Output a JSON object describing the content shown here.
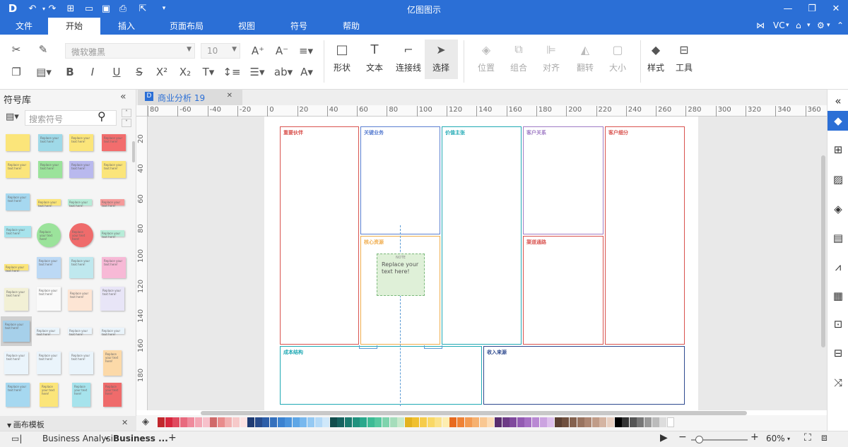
{
  "app": {
    "title": "亿图图示",
    "accent_color": "#2b6fd6",
    "quick_access_icons": [
      "logo-icon",
      "undo-icon",
      "redo-icon",
      "new-icon",
      "open-icon",
      "save-icon",
      "print-icon",
      "export-icon",
      "more-icon"
    ],
    "window_controls": [
      "minimize-icon",
      "maximize-icon",
      "close-icon"
    ]
  },
  "menu": {
    "items": [
      "文件",
      "开始",
      "插入",
      "页面布局",
      "视图",
      "符号",
      "帮助"
    ],
    "active": "开始",
    "user": "VC"
  },
  "ribbon": {
    "font_name": "微软雅黑",
    "font_size": "10",
    "tools": [
      {
        "label": "形状",
        "icon": "shape-icon",
        "enabled": true
      },
      {
        "label": "文本",
        "icon": "text-icon",
        "enabled": true
      },
      {
        "label": "连接线",
        "icon": "connector-icon",
        "enabled": true
      },
      {
        "label": "选择",
        "icon": "select-icon",
        "enabled": true
      }
    ],
    "arrange": [
      {
        "label": "位置",
        "icon": "position-icon",
        "enabled": false
      },
      {
        "label": "组合",
        "icon": "group-icon",
        "enabled": false
      },
      {
        "label": "对齐",
        "icon": "align-icon",
        "enabled": false
      },
      {
        "label": "翻转",
        "icon": "flip-icon",
        "enabled": false
      },
      {
        "label": "大小",
        "icon": "size-icon",
        "enabled": false
      }
    ],
    "style_label": "样式",
    "tools_label": "工具"
  },
  "symbol_library": {
    "title": "符号库",
    "search_placeholder": "搜索符号",
    "footer": "画布模板",
    "note_text": "Replace your text here!"
  },
  "document": {
    "tab_title": "商业分析 19",
    "h_ruler": [
      "80",
      "-60",
      "-40",
      "-20",
      "0",
      "20",
      "40",
      "60",
      "80",
      "100",
      "120",
      "140",
      "160",
      "180",
      "200",
      "220",
      "240",
      "260",
      "280",
      "300",
      "320",
      "340",
      "360"
    ],
    "v_ruler": [
      "20",
      "40",
      "60",
      "80",
      "100",
      "120",
      "140",
      "160",
      "180"
    ],
    "canvas": {
      "cells": [
        {
          "title": "重要伙伴",
          "color": "#d9534f"
        },
        {
          "title": "关键业务",
          "color": "#5b7fd1"
        },
        {
          "title": "价值主张",
          "color": "#20a9b4"
        },
        {
          "title": "客户关系",
          "color": "#a07cc5"
        },
        {
          "title": "客户细分",
          "color": "#d9534f"
        },
        {
          "title": "核心资源",
          "color": "#f0ad4e"
        },
        {
          "title": "渠道通路",
          "color": "#d9534f"
        },
        {
          "title": "成本结构",
          "color": "#20a9b4"
        },
        {
          "title": "收入来源",
          "color": "#2e4a8f"
        }
      ],
      "note": {
        "title": "NOTE",
        "text": "Replace your text here!"
      }
    }
  },
  "palette": {
    "colors": [
      "#c1272d",
      "#d7263d",
      "#e04a5f",
      "#e86a7e",
      "#ef8a9c",
      "#f3a6b4",
      "#f7c1cb",
      "#d06a6a",
      "#e88c8c",
      "#f1b0b0",
      "#f6c9c9",
      "#fbe2e2",
      "#1f3b73",
      "#274b8c",
      "#2d5ea8",
      "#3470bd",
      "#3b82d0",
      "#4a94dd",
      "#5ea6e6",
      "#78b8ee",
      "#94c9f3",
      "#b3d9f7",
      "#cfe8fa",
      "#114d4d",
      "#16625f",
      "#1a7a6f",
      "#21927f",
      "#2aa88c",
      "#3dbb95",
      "#57c8a0",
      "#7ed3ad",
      "#a5ddbb",
      "#c8e9cc",
      "#e3b21f",
      "#f0c030",
      "#f6cc4a",
      "#f9d866",
      "#fbe28a",
      "#fdedb0",
      "#e86a1f",
      "#ef8236",
      "#f39a52",
      "#f6b170",
      "#f9c792",
      "#fcdcb6",
      "#5a2e6e",
      "#6d3b86",
      "#80499d",
      "#935bb2",
      "#a670c4",
      "#b989d3",
      "#cba3e0",
      "#ddc0ec",
      "#5c4033",
      "#70503f",
      "#84614e",
      "#98735f",
      "#ac8672",
      "#c09c88",
      "#d4b4a2",
      "#e7cfc1",
      "#000000",
      "#333333",
      "#555555",
      "#777777",
      "#999999",
      "#bbbbbb",
      "#dddddd",
      "#ffffff"
    ]
  },
  "status": {
    "page_tabs": [
      "Business Analysi",
      "Business ..."
    ],
    "zoom": "60%"
  }
}
